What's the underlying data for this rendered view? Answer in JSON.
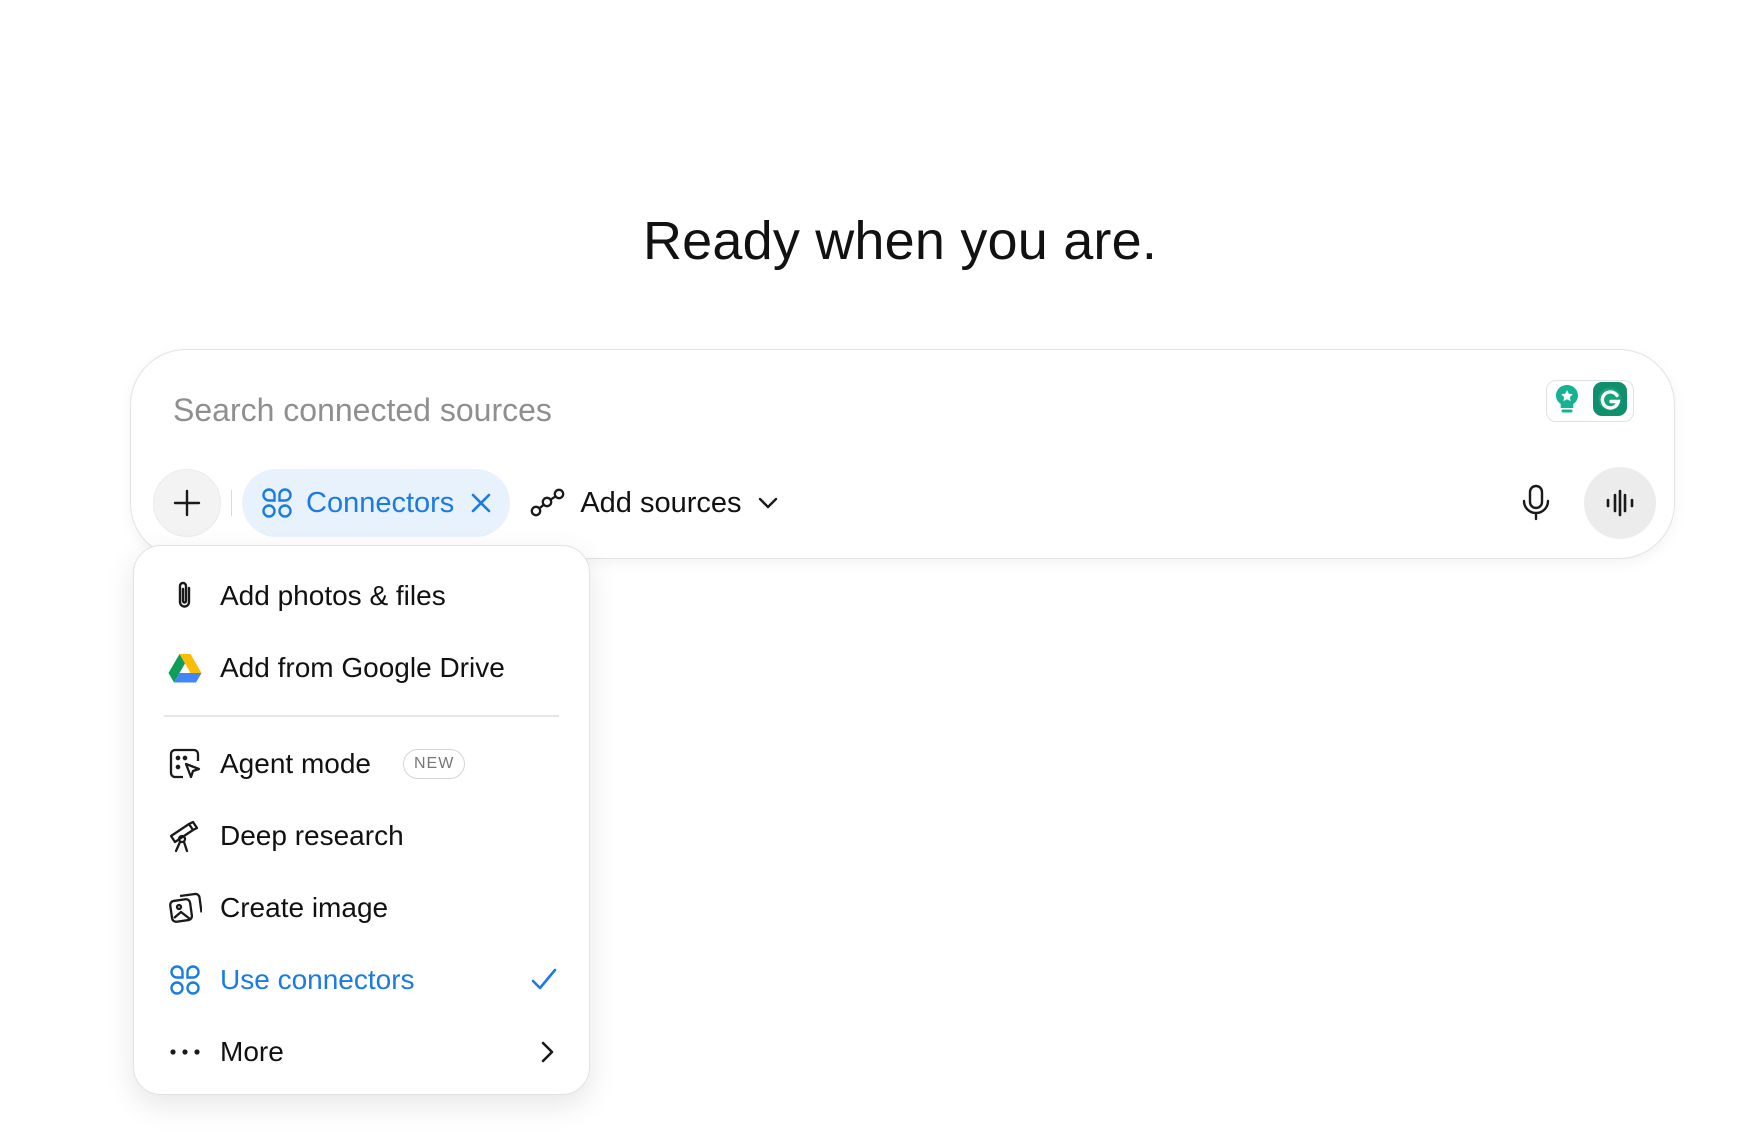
{
  "headline": "Ready when you are.",
  "composer": {
    "placeholder": "Search connected sources",
    "extensions": [
      "lightbulb-icon",
      "grammarly-icon"
    ],
    "chip_label": "Connectors",
    "add_sources_label": "Add sources"
  },
  "menu": {
    "items": [
      {
        "label": "Add photos & files",
        "icon": "paperclip-icon"
      },
      {
        "label": "Add from Google Drive",
        "icon": "google-drive-icon"
      },
      {
        "label": "Agent mode",
        "icon": "agent-cursor-icon",
        "badge": "NEW"
      },
      {
        "label": "Deep research",
        "icon": "telescope-icon"
      },
      {
        "label": "Create image",
        "icon": "image-icon"
      },
      {
        "label": "Use connectors",
        "icon": "connectors-icon",
        "selected": true
      },
      {
        "label": "More",
        "icon": "dots-icon"
      }
    ]
  },
  "colors": {
    "accent": "#1a7ae6",
    "chip_bg": "#e8f2fd",
    "grammarly": "#15a37a"
  }
}
